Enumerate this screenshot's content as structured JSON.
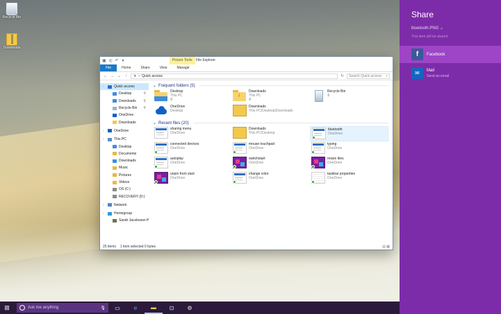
{
  "desktop": {
    "icons": [
      {
        "label": "Recycle Bin",
        "icon": "recycle-bin-icon"
      },
      {
        "label": "Downloads",
        "icon": "zip-folder-icon"
      }
    ]
  },
  "explorer": {
    "quick_access_toolbar": [
      "folder-icon",
      "properties-icon",
      "undo-icon",
      "dropdown-icon"
    ],
    "contextual_tab": "Picture Tools",
    "title": "File Explorer",
    "ribbon_tabs": [
      "File",
      "Home",
      "Share",
      "View",
      "Manage"
    ],
    "address": "Quick access",
    "search_placeholder": "Search Quick access",
    "nav": [
      {
        "label": "Quick access",
        "icon": "star-icon",
        "level": 0,
        "selected": true
      },
      {
        "label": "Desktop",
        "icon": "desktop-icon",
        "level": 1,
        "pinned": true
      },
      {
        "label": "Downloads",
        "icon": "downloads-icon",
        "level": 1,
        "pinned": true
      },
      {
        "label": "Recycle Bin",
        "icon": "recycle-bin-icon",
        "level": 1,
        "pinned": true
      },
      {
        "label": "OneDrive",
        "icon": "onedrive-icon",
        "level": 1
      },
      {
        "label": "Downloads",
        "icon": "folder-icon",
        "level": 1
      },
      {
        "label": "OneDrive",
        "icon": "onedrive-icon",
        "level": 0
      },
      {
        "label": "This PC",
        "icon": "computer-icon",
        "level": 0
      },
      {
        "label": "Desktop",
        "icon": "desktop-icon",
        "level": 1
      },
      {
        "label": "Documents",
        "icon": "documents-icon",
        "level": 1
      },
      {
        "label": "Downloads",
        "icon": "downloads-icon",
        "level": 1
      },
      {
        "label": "Music",
        "icon": "music-icon",
        "level": 1
      },
      {
        "label": "Pictures",
        "icon": "pictures-icon",
        "level": 1
      },
      {
        "label": "Videos",
        "icon": "videos-icon",
        "level": 1
      },
      {
        "label": "OS (C:)",
        "icon": "drive-icon",
        "level": 1
      },
      {
        "label": "RECOVERY (D:)",
        "icon": "drive-icon",
        "level": 1
      },
      {
        "label": "Network",
        "icon": "network-icon",
        "level": 0
      },
      {
        "label": "Homegroup",
        "icon": "homegroup-icon",
        "level": 0
      },
      {
        "label": "Sarah Jacobsson P",
        "icon": "user-icon",
        "level": 1
      }
    ],
    "frequent_header": "Frequent folders (5)",
    "frequent": [
      {
        "name": "Desktop",
        "sub": "This PC",
        "thumb": "folder desk",
        "pinned": true
      },
      {
        "name": "Downloads",
        "sub": "This PC",
        "thumb": "folder down",
        "pinned": true
      },
      {
        "name": "Recycle Bin",
        "sub": "",
        "thumb": "bin",
        "pinned": true
      },
      {
        "name": "OneDrive",
        "sub": "Desktop",
        "thumb": "cloud",
        "pinned": false
      },
      {
        "name": "Downloads",
        "sub": "This PC\\Desktop\\Downloads",
        "thumb": "zip",
        "pinned": false
      }
    ],
    "recent_header": "Recent files (20)",
    "recent": [
      {
        "name": "sharing menu",
        "sub": "OneDrive",
        "thumb": "screen",
        "sync": false
      },
      {
        "name": "Downloads",
        "sub": "This PC\\Desktop",
        "thumb": "zip",
        "sync": false
      },
      {
        "name": "bluetooth",
        "sub": "OneDrive",
        "thumb": "screen",
        "sync": true,
        "selected": true
      },
      {
        "name": "connected devices",
        "sub": "OneDrive",
        "thumb": "screen",
        "sync": true
      },
      {
        "name": "mouse touchpad",
        "sub": "OneDrive",
        "thumb": "screen",
        "sync": true
      },
      {
        "name": "typing",
        "sub": "OneDrive",
        "thumb": "screen",
        "sync": true
      },
      {
        "name": "autoplay",
        "sub": "OneDrive",
        "thumb": "screen",
        "sync": true
      },
      {
        "name": "switchstart",
        "sub": "OneDrive",
        "thumb": "purple",
        "sync": true
      },
      {
        "name": "resize tiles",
        "sub": "OneDrive",
        "thumb": "purple",
        "sync": true
      },
      {
        "name": "unpin from start",
        "sub": "OneDrive",
        "thumb": "purple",
        "sync": true
      },
      {
        "name": "change color",
        "sub": "OneDrive",
        "thumb": "screen",
        "sync": true
      },
      {
        "name": "taskbar properties",
        "sub": "OneDrive",
        "thumb": "doc",
        "sync": true
      }
    ],
    "status": {
      "count": "25 items",
      "selection": "1 item selected  0 bytes"
    }
  },
  "taskbar": {
    "search_placeholder": "Ask me anything",
    "icons": [
      "task-view-icon",
      "edge-icon",
      "file-explorer-icon",
      "store-icon",
      "settings-icon"
    ]
  },
  "share": {
    "title": "Share",
    "filename": "bluetooth.PNG",
    "note": "This item will be shared",
    "apps": [
      {
        "name": "Facebook",
        "sub": "",
        "tile": "fb",
        "glyph": "f",
        "highlighted": true
      },
      {
        "name": "Mail",
        "sub": "Send an email",
        "tile": "mail",
        "glyph": "✉",
        "highlighted": false
      }
    ]
  },
  "colors": {
    "share_bg": "#7d2ca9",
    "share_highlight": "#9e44c7",
    "file_tab": "#1979ca",
    "taskbar": "#2b1a3c"
  }
}
